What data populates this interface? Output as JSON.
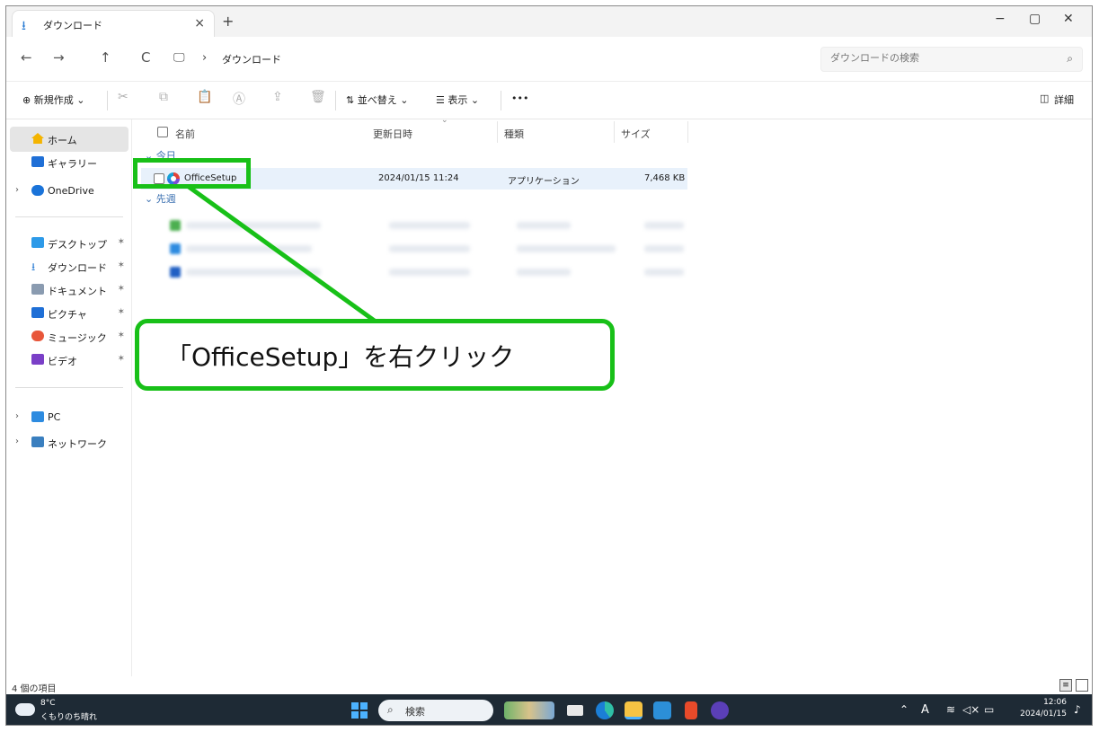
{
  "window": {
    "tab_title": "ダウンロード",
    "tab_close": "×",
    "new_tab": "+",
    "controls": {
      "minimize": "−",
      "maximize": "▢",
      "close": "✕"
    }
  },
  "address": {
    "back": "←",
    "forward": "→",
    "up": "↑",
    "refresh": "C",
    "breadcrumb_sep": "›",
    "breadcrumb": "ダウンロード",
    "search_placeholder": "ダウンロードの検索",
    "search_icon": "search-icon"
  },
  "toolbar": {
    "new": "⊕ 新規作成 ⌄",
    "sort": "⇅ 並べ替え ⌄",
    "view": "☰ 表示 ⌄",
    "more": "•••",
    "details": "詳細"
  },
  "sidebar": {
    "items": [
      {
        "label": "ホーム",
        "icon": "home-icon"
      },
      {
        "label": "ギャラリー",
        "icon": "gallery-icon"
      },
      {
        "label": "OneDrive",
        "icon": "cloud-icon"
      },
      {
        "label": "デスクトップ",
        "icon": "desktop-icon"
      },
      {
        "label": "ダウンロード",
        "icon": "download-icon"
      },
      {
        "label": "ドキュメント",
        "icon": "document-icon"
      },
      {
        "label": "ピクチャ",
        "icon": "pictures-icon"
      },
      {
        "label": "ミュージック",
        "icon": "music-icon"
      },
      {
        "label": "ビデオ",
        "icon": "video-icon"
      },
      {
        "label": "PC",
        "icon": "pc-icon"
      },
      {
        "label": "ネットワーク",
        "icon": "network-icon"
      }
    ]
  },
  "columns": {
    "name": "名前",
    "date": "更新日時",
    "type": "種類",
    "size": "サイズ"
  },
  "groups": {
    "today": "今日",
    "last_week": "先週"
  },
  "files": [
    {
      "name": "OfficeSetup",
      "date": "2024/01/15 11:24",
      "type": "アプリケーション",
      "size": "7,468 KB"
    }
  ],
  "callout": "「OfficeSetup」を右クリック",
  "status": {
    "item_count": "4 個の項目"
  },
  "taskbar": {
    "temperature": "8°C",
    "weather": "くもりのち晴れ",
    "search": "検索",
    "time": "12:06",
    "date": "2024/01/15"
  },
  "colors": {
    "highlight": "#18c018",
    "selected_row": "#e8f1fb",
    "taskbar": "#1e2a35"
  }
}
